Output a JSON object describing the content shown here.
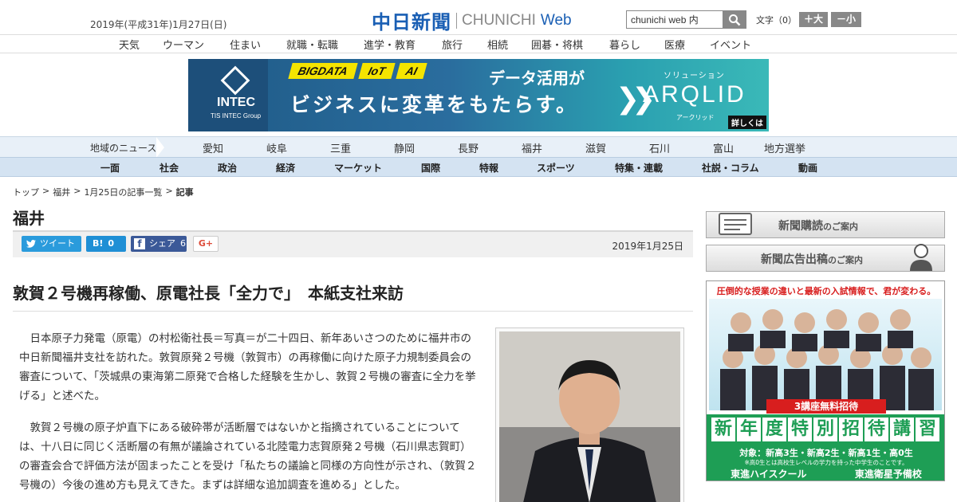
{
  "header": {
    "date": "2019年(平成31年)1月27日(日)",
    "logo_kanji": "中日新聞",
    "logo_en": "CHUNICHI",
    "logo_web": "Web",
    "search_value": "chunichi web 内",
    "font_size_label": "文字（0）",
    "font_large": "＋大",
    "font_small": "－小"
  },
  "category_nav": [
    "天気",
    "ウーマン",
    "住まい",
    "就職・転職",
    "進学・教育",
    "旅行",
    "相続",
    "囲碁・将棋",
    "暮らし",
    "医療",
    "イベント"
  ],
  "banner": {
    "company": "INTEC",
    "company_sub": "TIS INTEC Group",
    "tags": [
      "BIGDATA",
      "IoT",
      "AI"
    ],
    "headline1": "データ活用が",
    "headline2": "ビジネスに変革をもたらす。",
    "solution_label": "ソリューション",
    "product": "ARQLID",
    "product_kana": "アークリッド",
    "more": "詳しくは"
  },
  "region_nav": {
    "label": "地域のニュース",
    "items": [
      "愛知",
      "岐阜",
      "三重",
      "静岡",
      "長野",
      "福井",
      "滋賀",
      "石川",
      "富山",
      "地方選挙"
    ]
  },
  "section_nav": [
    "一面",
    "社会",
    "政治",
    "経済",
    "マーケット",
    "国際",
    "特報",
    "スポーツ",
    "特集・連載",
    "社説・コラム",
    "動画"
  ],
  "breadcrumb": {
    "items": [
      "トップ",
      "福井",
      "1月25日の記事一覧"
    ],
    "separator": ">",
    "current": "記事"
  },
  "region_title": "福井",
  "share": {
    "tweet": "ツイート",
    "hatena_count": "0",
    "facebook": "シェア",
    "facebook_count": "6",
    "gplus": "G+"
  },
  "article": {
    "pub_date": "2019年1月25日",
    "headline": "敦賀２号機再稼働、原電社長「全力で」　本紙支社来訪",
    "paragraphs": [
      "日本原子力発電（原電）の村松衛社長＝写真＝が二十四日、新年あいさつのために福井市の中日新聞福井支社を訪れた。敦賀原発２号機（敦賀市）の再稼働に向けた原子力規制委員会の審査について、「茨城県の東海第二原発で合格した経験を生かし、敦賀２号機の審査に全力を挙げる」と述べた。",
      "敦賀２号機の原子炉直下にある破砕帯が活断層ではないかと指摘されていることについては、十八日に同じく活断層の有無が議論されている北陸電力志賀原発２号機（石川県志賀町）の審査会合で評価方法が固まったことを受け「私たちの議論と同様の方向性が示され、（敦賀２号機の）今後の進め方も見えてきた。まずは詳細な追加調査を進める」とした。"
    ]
  },
  "sidebar": {
    "subscribe": "新聞購読",
    "subscribe_suffix": "のご案内",
    "advertise": "新聞広告出稿",
    "advertise_suffix": "のご案内",
    "ad": {
      "top": "圧倒的な授業の違いと最新の入試情報で、君が変わる。",
      "free": "3講座無料招待",
      "big_chars": [
        "新",
        "年",
        "度",
        "特",
        "別",
        "招",
        "待",
        "講",
        "習"
      ],
      "target": "対象：新高3生・新高2生・新高1生・高0生",
      "note": "※高0生とは高校生レベルの学力を持った中学生のことです。",
      "school1": "東進ハイスクール",
      "school2": "東進衛星予備校"
    }
  },
  "colors": {
    "brand_blue": "#1a5fb4",
    "twitter": "#2a9bdc",
    "facebook": "#3b5998",
    "ad_green": "#1e9e55",
    "ad_red": "#d81e1e"
  }
}
